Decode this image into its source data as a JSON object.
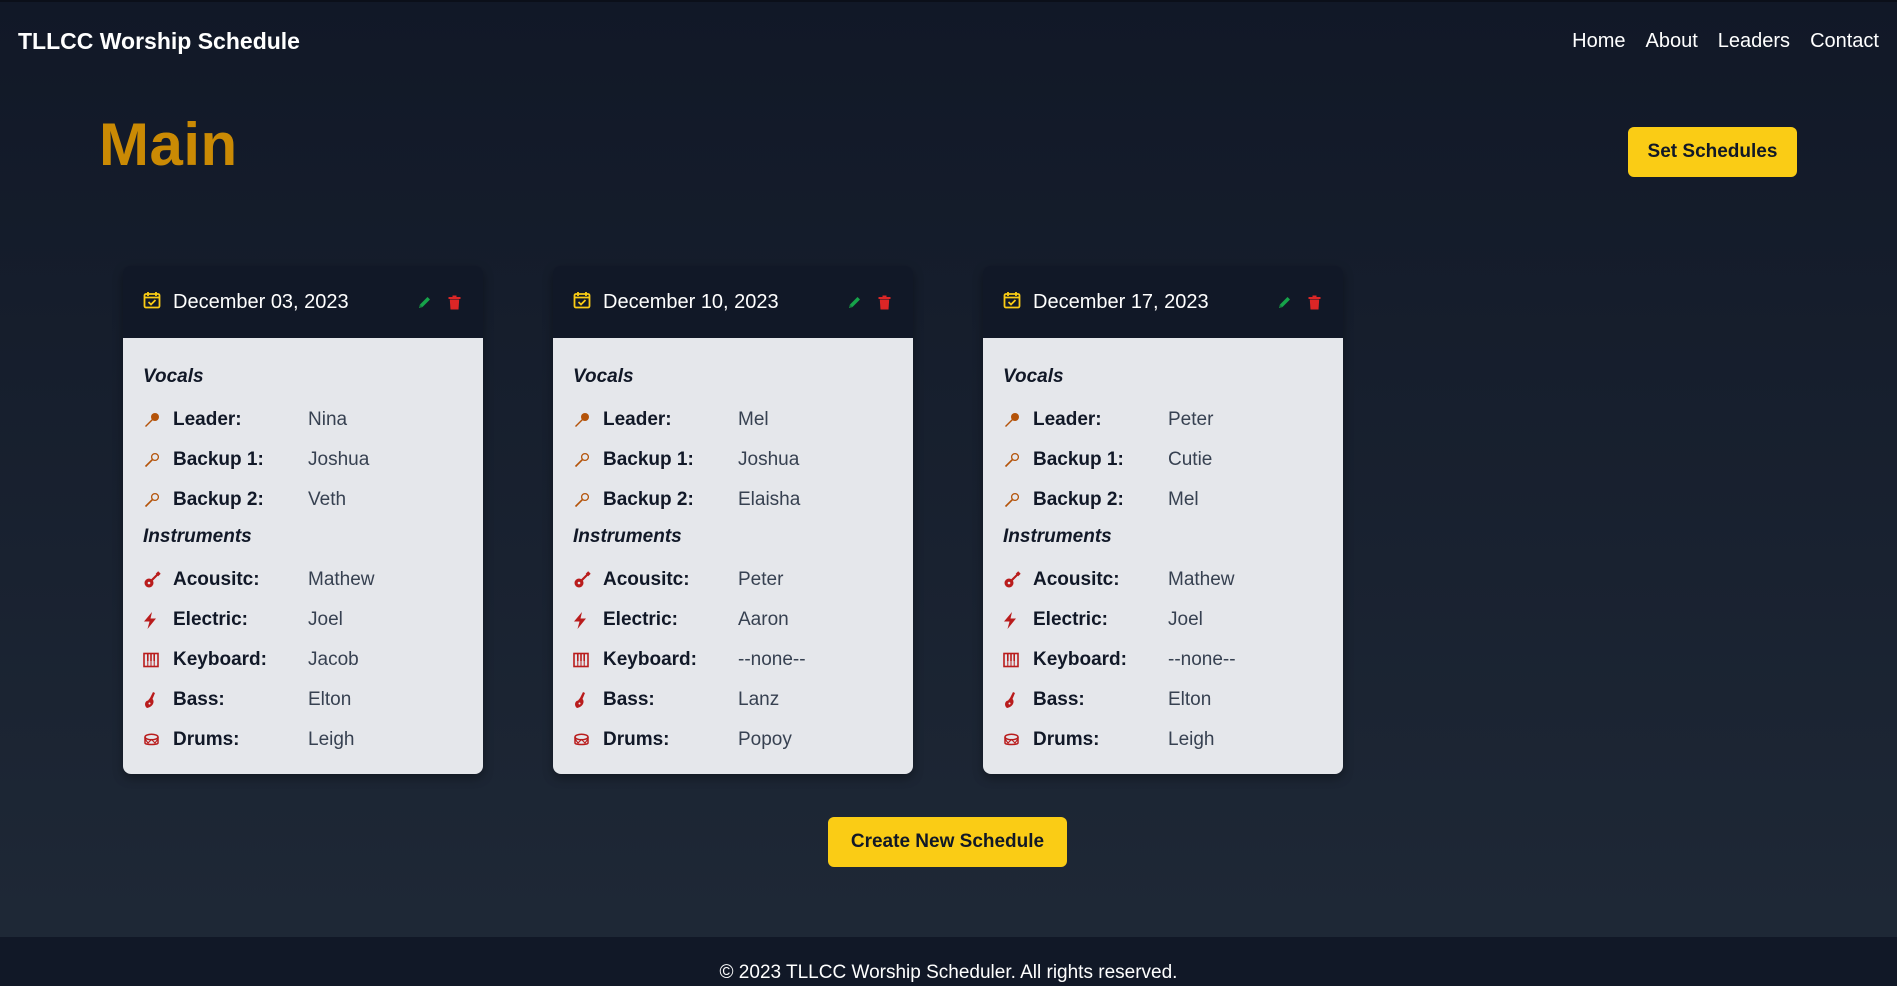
{
  "navbar": {
    "brand": "TLLCC Worship Schedule",
    "links": [
      "Home",
      "About",
      "Leaders",
      "Contact"
    ]
  },
  "main": {
    "title": "Main",
    "set_schedules_label": "Set Schedules",
    "create_label": "Create New Schedule"
  },
  "labels": {
    "vocals": "Vocals",
    "instruments": "Instruments",
    "leader": "Leader:",
    "backup1": "Backup 1:",
    "backup2": "Backup 2:",
    "acoustic": "Acousitc:",
    "electric": "Electric:",
    "keyboard": "Keyboard:",
    "bass": "Bass:",
    "drums": "Drums:"
  },
  "schedules": [
    {
      "date": "December 03, 2023",
      "leader": "Nina",
      "backup1": "Joshua",
      "backup2": "Veth",
      "acoustic": "Mathew",
      "electric": "Joel",
      "keyboard": "Jacob",
      "bass": "Elton",
      "drums": "Leigh"
    },
    {
      "date": "December 10, 2023",
      "leader": "Mel",
      "backup1": "Joshua",
      "backup2": "Elaisha",
      "acoustic": "Peter",
      "electric": "Aaron",
      "keyboard": "--none--",
      "bass": "Lanz",
      "drums": "Popoy"
    },
    {
      "date": "December 17, 2023",
      "leader": "Peter",
      "backup1": "Cutie",
      "backup2": "Mel",
      "acoustic": "Mathew",
      "electric": "Joel",
      "keyboard": "--none--",
      "bass": "Elton",
      "drums": "Leigh"
    }
  ],
  "footer": {
    "text": "© 2023 TLLCC Worship Scheduler. All rights reserved."
  },
  "colors": {
    "accent": "#facc15",
    "title": "#ca8a04",
    "edit": "#16a34a",
    "delete": "#dc2626",
    "instrument_icon": "#b91c1c",
    "mic_icon": "#b45309"
  }
}
